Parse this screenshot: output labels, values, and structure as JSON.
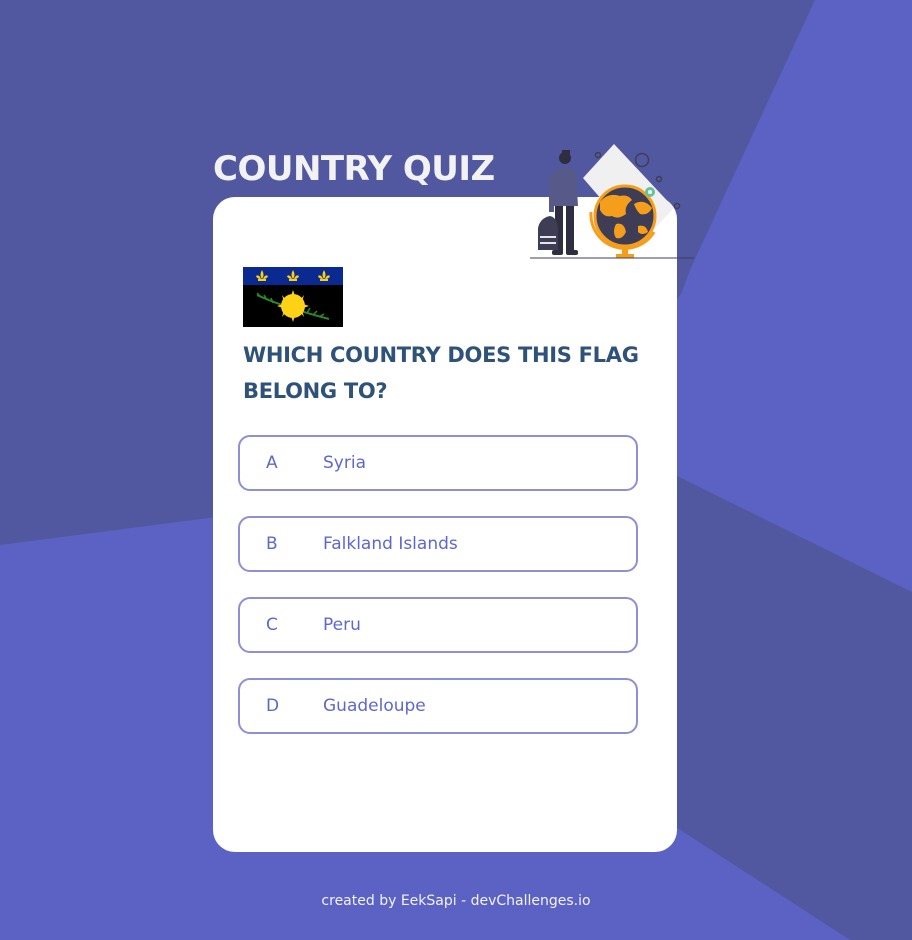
{
  "app": {
    "title": "COUNTRY QUIZ"
  },
  "quiz": {
    "question": "WHICH COUNTRY DOES THIS FLAG BELONG TO?",
    "flag_icon": "guadeloupe-flag-icon",
    "options": [
      {
        "letter": "A",
        "label": "Syria"
      },
      {
        "letter": "B",
        "label": "Falkland Islands"
      },
      {
        "letter": "C",
        "label": "Peru"
      },
      {
        "letter": "D",
        "label": "Guadeloupe"
      }
    ]
  },
  "footer": {
    "credit": "created by EekSapi - devChallenges.io"
  },
  "colors": {
    "background": "#5c62c3",
    "background_dark": "#5258a0",
    "card": "#ffffff",
    "title": "#f2f2f2",
    "question": "#2f527b",
    "option_border": "#8e8fd6",
    "option_text": "#6066d0"
  }
}
